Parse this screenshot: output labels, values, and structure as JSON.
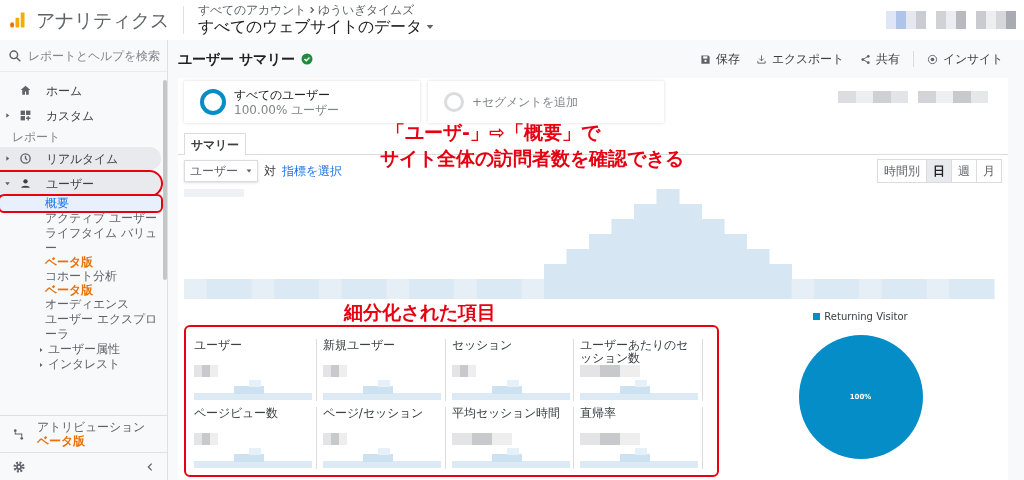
{
  "header": {
    "app_name": "アナリティクス",
    "breadcrumb": [
      "すべてのアカウント",
      "ゆういぎタイムズ"
    ],
    "view": "すべてのウェブサイトのデータ"
  },
  "sidebar": {
    "search_placeholder": "レポートとヘルプを検索",
    "items": [
      {
        "kind": "home",
        "label": "ホーム"
      },
      {
        "kind": "custom",
        "label": "カスタム",
        "expanded": false
      },
      {
        "kind": "section",
        "label": "レポート"
      },
      {
        "kind": "realtime",
        "label": "リアルタイム",
        "expanded": false,
        "shaded": true,
        "annotated": false
      },
      {
        "kind": "audience",
        "label": "ユーザー",
        "expanded": true,
        "shaded": true,
        "annotated": true,
        "children": [
          {
            "label": "概要",
            "selected": true,
            "annotated": true
          },
          {
            "label": "アクティブ ユーザー",
            "selected": false,
            "annotated": false
          },
          {
            "label": "ライフタイム バリュー",
            "selected": false,
            "annotated": false,
            "badge": "ベータ版"
          },
          {
            "label": "コホート分析",
            "selected": false,
            "annotated": false,
            "badge": "ベータ版"
          },
          {
            "label": "オーディエンス",
            "selected": false,
            "annotated": false
          },
          {
            "label": "ユーザー エクスプローラ",
            "selected": false,
            "annotated": false
          },
          {
            "label": "ユーザー属性",
            "selected": false,
            "annotated": false,
            "expanded": false
          },
          {
            "label": "インタレスト",
            "selected": false,
            "annotated": false,
            "expanded": false
          }
        ]
      }
    ],
    "attribution": {
      "label": "アトリビューション",
      "badge": "ベータ版"
    }
  },
  "main": {
    "title": "ユーザー サマリー",
    "verified": true,
    "actions": [
      {
        "kind": "save",
        "label": "保存"
      },
      {
        "kind": "export",
        "label": "エクスポート"
      },
      {
        "kind": "share",
        "label": "共有"
      },
      {
        "kind": "insight",
        "label": "インサイト"
      }
    ],
    "segments": [
      {
        "kind": "segment",
        "name": "すべてのユーザー",
        "detail": "100.00% ユーザー"
      },
      {
        "kind": "add",
        "name": "+セグメントを追加"
      }
    ],
    "tabs": [
      {
        "label": "サマリー",
        "selected": true
      }
    ],
    "metric_select": {
      "value": "ユーザー",
      "versus": "対",
      "link": "指標を選択"
    },
    "granularity": [
      {
        "label": "時間別",
        "selected": false
      },
      {
        "label": "日",
        "selected": true
      },
      {
        "label": "週",
        "selected": false
      },
      {
        "label": "月",
        "selected": false
      }
    ],
    "callout": [
      "「ユーザ-」⇨「概要」で",
      "サイト全体の訪問者数を確認できる"
    ],
    "metrics_callout": "細分化された項目",
    "metrics": {
      "annotated": true,
      "items": [
        {
          "label": "ユーザー"
        },
        {
          "label": "新規ユーザー"
        },
        {
          "label": "セッション"
        },
        {
          "label": "ユーザーあたりのセッション数"
        },
        {
          "label": "ページビュー数"
        },
        {
          "label": "ページ/セッション"
        },
        {
          "label": "平均セッション時間"
        },
        {
          "label": "直帰率"
        }
      ]
    },
    "pie": {
      "chart_data": {
        "type": "pie",
        "categories": [
          "Returning Visitor"
        ],
        "series": [
          {
            "color": "#058dc7",
            "values": [
              100
            ]
          }
        ],
        "value_labels": [
          "100%"
        ]
      }
    }
  }
}
